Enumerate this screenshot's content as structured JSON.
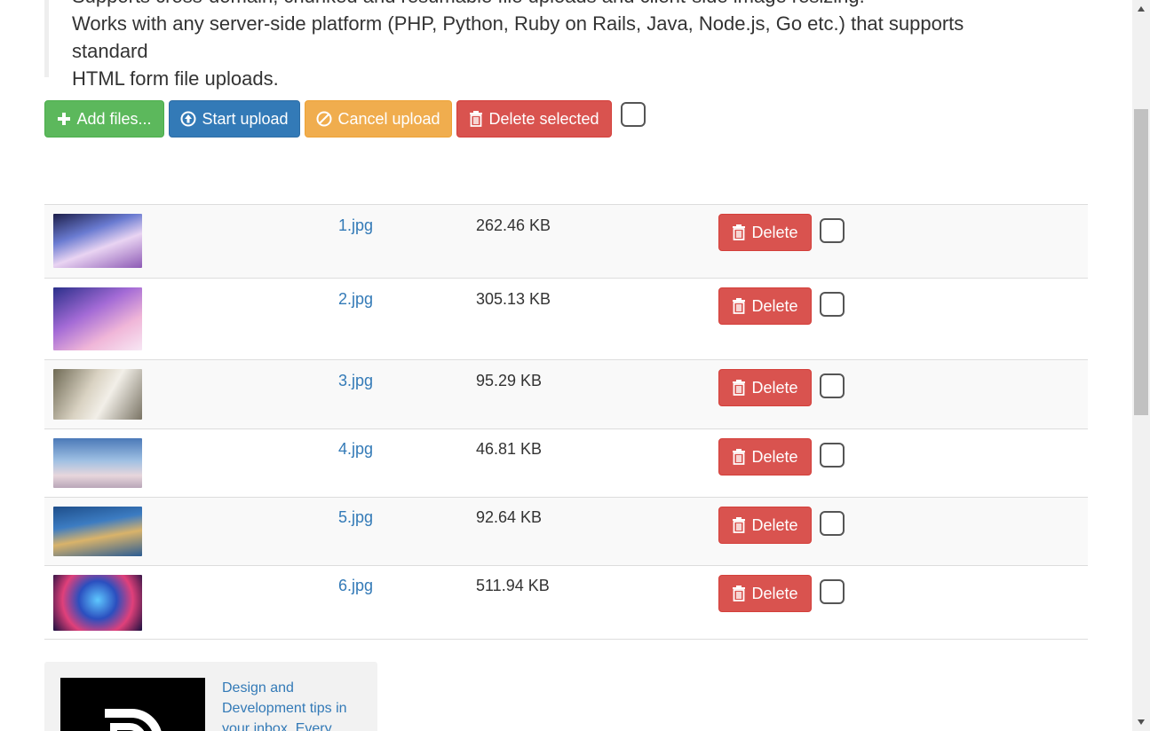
{
  "description": {
    "line1": "Supports cross-domain, chunked and resumable file uploads and client-side image resizing.",
    "line2": "Works with any server-side platform (PHP, Python, Ruby on Rails, Java, Node.js, Go etc.) that supports standard",
    "line3": "HTML form file uploads."
  },
  "toolbar": {
    "add_label": "Add files...",
    "start_label": "Start upload",
    "cancel_label": "Cancel upload",
    "delete_selected_label": "Delete selected"
  },
  "files": [
    {
      "name": "1.jpg",
      "size": "262.46 KB",
      "delete_label": "Delete"
    },
    {
      "name": "2.jpg",
      "size": "305.13 KB",
      "delete_label": "Delete"
    },
    {
      "name": "3.jpg",
      "size": "95.29 KB",
      "delete_label": "Delete"
    },
    {
      "name": "4.jpg",
      "size": "46.81 KB",
      "delete_label": "Delete"
    },
    {
      "name": "5.jpg",
      "size": "92.64 KB",
      "delete_label": "Delete"
    },
    {
      "name": "6.jpg",
      "size": "511.94 KB",
      "delete_label": "Delete"
    }
  ],
  "ad": {
    "text": "Design and Development tips in your inbox. Every"
  },
  "colors": {
    "success": "#5cb85c",
    "primary": "#337ab7",
    "warning": "#f0ad4e",
    "danger": "#d9534f"
  }
}
